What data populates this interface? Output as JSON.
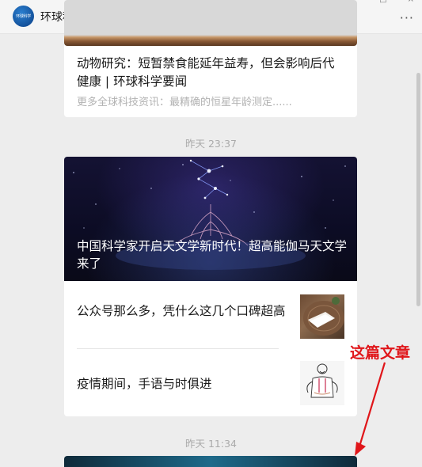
{
  "header": {
    "account_name": "环球科学",
    "avatar_text": "环球科学",
    "more_glyph": "···"
  },
  "window_controls": [
    "—",
    "□",
    "×"
  ],
  "messages": [
    {
      "title": "动物研究：短暂禁食能延年益寿，但会影响后代健康 | 环球科学要闻",
      "desc": "更多全球科技资讯：最精确的恒星年龄测定......"
    }
  ],
  "timestamps": [
    "昨天 23:37",
    "昨天 11:34"
  ],
  "group": {
    "hero_title": "中国科学家开启天文学新时代！超高能伽马天文学来了",
    "items": [
      {
        "title": "公众号那么多，凭什么这几个口碑超高",
        "thumb_icon": "towel-on-wood-thumbnail"
      },
      {
        "title": "疫情期间，手语与时俱进",
        "thumb_icon": "sign-language-person-thumbnail"
      }
    ]
  },
  "annotation": {
    "label": "这篇文章",
    "color": "#e0161a"
  },
  "colors": {
    "background": "#ededed",
    "card": "#ffffff",
    "muted_text": "#b2b2b2"
  }
}
